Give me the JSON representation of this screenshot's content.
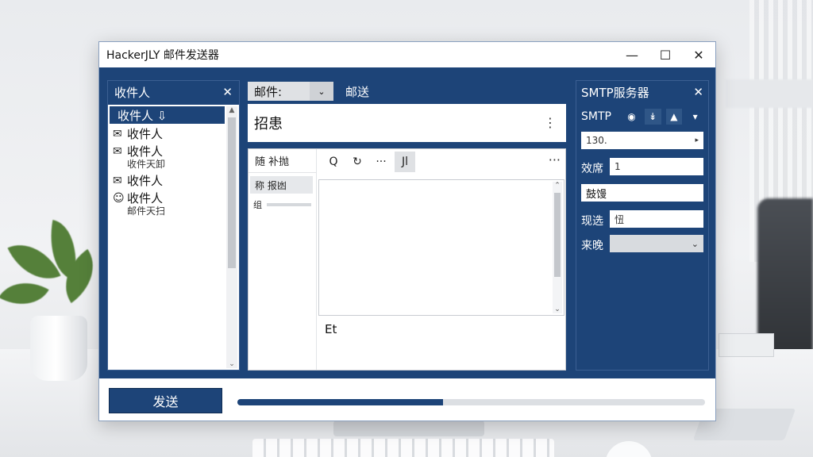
{
  "window": {
    "title": "HackerJLY 邮件发送器",
    "minimize_icon": "—",
    "maximize_icon": "☐",
    "close_icon": "✕"
  },
  "recipients": {
    "title": "收件人",
    "close_icon": "✕",
    "selected": "收件人 ⇩",
    "items": [
      {
        "icon": "✉",
        "name": "收件人",
        "sub": ""
      },
      {
        "icon": "✉",
        "name": "收件人",
        "sub": "收件天卸"
      },
      {
        "icon": "✉",
        "name": "收件人",
        "sub": ""
      },
      {
        "icon": "☺",
        "name": "收件人",
        "sub": "邮件天扫"
      }
    ]
  },
  "compose": {
    "mail_tab": "邮件:",
    "mail_tab_dropdown": "⌄",
    "send_tab": "邮送",
    "subject": "招患",
    "subject_more": "⋮",
    "editor_tab": "随 补抛",
    "editor_row": "称 报凼",
    "editor_row2": "组",
    "toolbar": {
      "search_icon": "Q",
      "refresh_icon": "↻",
      "more_icon": "···",
      "format_icon": "Jl",
      "overflow_icon": "···"
    },
    "footer_text": "Et"
  },
  "smtp": {
    "title": "SMTP服务器",
    "close_icon": "✕",
    "label": "SMTP",
    "icons": [
      "◉",
      "↡",
      "▲",
      "▾"
    ],
    "host_value": "130.",
    "host_dropdown": "▸",
    "port_label": "效席",
    "port_value": "1",
    "user_value": "鼓馒",
    "pass_label": "现选",
    "pass_value": "忸",
    "mode_label": "来晚",
    "mode_value": "",
    "mode_dropdown": "⌄"
  },
  "bottom": {
    "send_button": "发送",
    "progress": 0.44
  },
  "colors": {
    "window_bg": "#1d4478",
    "accent": "#1d4478"
  }
}
